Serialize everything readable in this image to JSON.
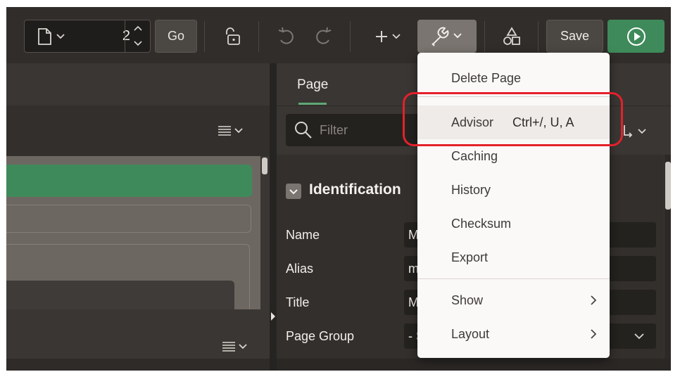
{
  "toolbar": {
    "page_number": "2",
    "go_label": "Go",
    "save_label": "Save",
    "icons": {
      "page": "page-icon",
      "lock": "unlock-icon",
      "undo": "undo-icon",
      "redo": "redo-icon",
      "create": "plus-icon",
      "utilities": "wrench-icon",
      "shared": "shapes-icon",
      "run": "play-icon"
    }
  },
  "right_panel": {
    "tab_page": "Page",
    "filter_placeholder": "Filter",
    "section_title": "Identification",
    "properties": [
      {
        "label": "Name",
        "value": "M"
      },
      {
        "label": "Alias",
        "value": "m"
      },
      {
        "label": "Title",
        "value": "M"
      },
      {
        "label": "Page Group",
        "value": "- S"
      }
    ]
  },
  "menu": {
    "items": [
      {
        "label": "Delete Page"
      },
      {
        "label": "Advisor",
        "shortcut": "Ctrl+/, U, A"
      },
      {
        "label": "Caching"
      },
      {
        "label": "History"
      },
      {
        "label": "Checksum"
      },
      {
        "label": "Export"
      },
      {
        "label": "Show"
      },
      {
        "label": "Layout"
      }
    ]
  },
  "colors": {
    "accent_green": "#3f8a5a",
    "highlight_ring": "#e3212b",
    "menu_bg": "#fbf9f8"
  }
}
